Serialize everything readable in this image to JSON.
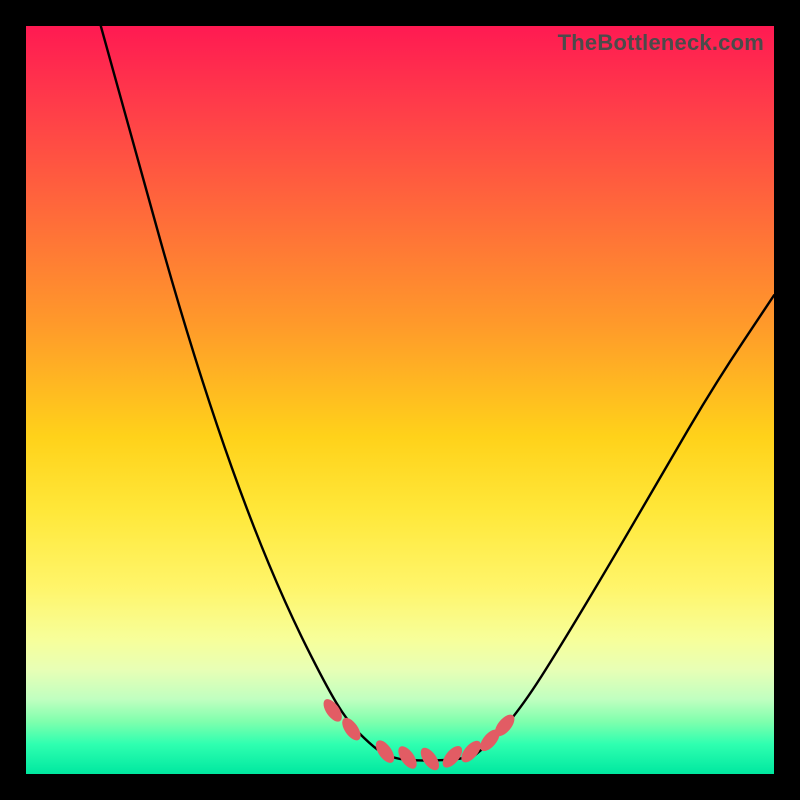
{
  "watermark": "TheBottleneck.com",
  "colors": {
    "frame_background": "#000000",
    "curve_stroke": "#000000",
    "marker_fill": "#e25c64",
    "marker_stroke": "#9c3a40"
  },
  "chart_data": {
    "type": "line",
    "title": "",
    "xlabel": "",
    "ylabel": "",
    "xlim": [
      0,
      100
    ],
    "ylim": [
      0,
      100
    ],
    "series": [
      {
        "name": "left-curve",
        "x": [
          10,
          15,
          20,
          25,
          30,
          35,
          40,
          43,
          46,
          48,
          50
        ],
        "y": [
          100,
          82,
          64,
          48,
          34,
          22,
          12,
          7,
          4,
          2.5,
          2
        ]
      },
      {
        "name": "valley-floor",
        "x": [
          50,
          52,
          55,
          58,
          60
        ],
        "y": [
          2,
          1.8,
          1.8,
          2,
          2.5
        ]
      },
      {
        "name": "right-curve",
        "x": [
          60,
          63,
          67,
          72,
          78,
          85,
          92,
          100
        ],
        "y": [
          2.5,
          5,
          10,
          18,
          28,
          40,
          52,
          64
        ]
      }
    ],
    "markers": {
      "name": "highlight-dots",
      "x": [
        41,
        43.5,
        48,
        51,
        54,
        57,
        59.5,
        62,
        64
      ],
      "y": [
        8.5,
        6,
        3,
        2.2,
        2,
        2.3,
        3,
        4.5,
        6.5
      ]
    }
  }
}
